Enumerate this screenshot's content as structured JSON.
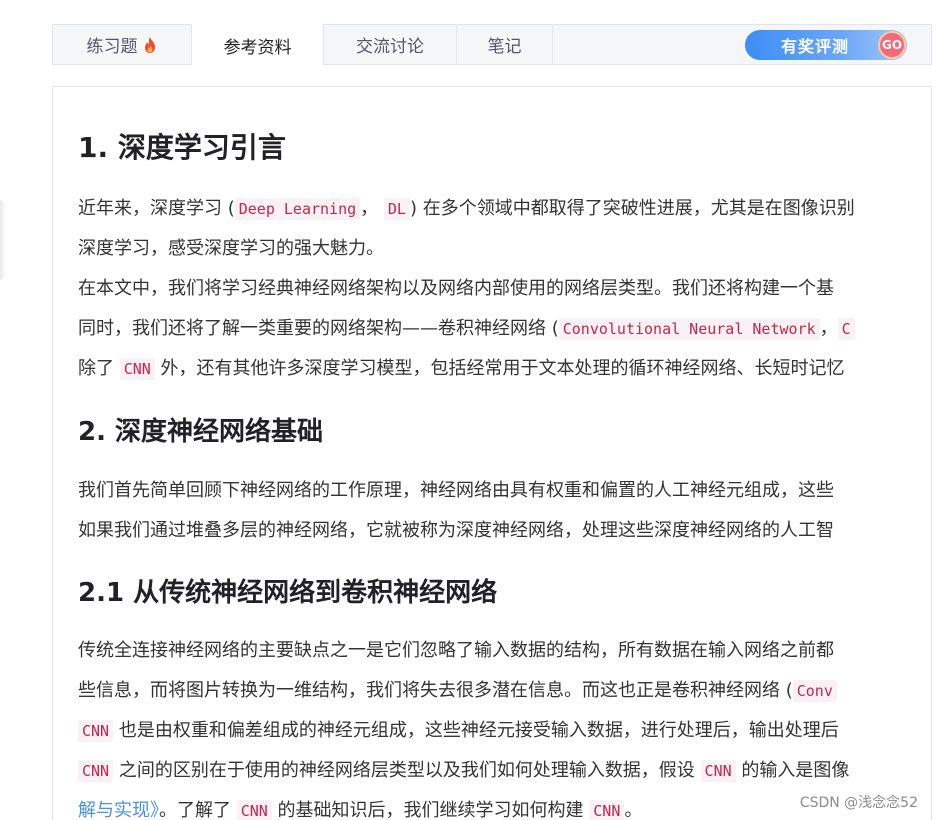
{
  "tabs": [
    {
      "label": "练习题",
      "icon": "fire-icon"
    },
    {
      "label": "参考资料"
    },
    {
      "label": "交流讨论"
    },
    {
      "label": "笔记"
    }
  ],
  "eval_button": {
    "label": "有奖评测",
    "badge": "GO"
  },
  "article": {
    "h1": "1. 深度学习引言",
    "p1": {
      "t1": "近年来，深度学习 (",
      "c1": "Deep Learning",
      "t2": "， ",
      "c2": "DL",
      "t3": ") 在多个领域中都取得了突破性进展，尤其是在图像识别",
      "line2": "深度学习，感受深度学习的强大魅力。"
    },
    "p2": {
      "line1": "在本文中，我们将学习经典神经网络架构以及网络内部使用的网络层类型。我们还将构建一个基",
      "l2_t1": "同时，我们还将了解一类重要的网络架构——卷积神经网络 (",
      "l2_c1": "Convolutional Neural Network",
      "l2_t2": "，",
      "l2_c2": "C",
      "l3_t1": "除了 ",
      "l3_c1": "CNN",
      "l3_t2": " 外，还有其他许多深度学习模型，包括经常用于文本处理的循环神经网络、长短时记忆"
    },
    "h2a": "2. 深度神经网络基础",
    "p3": {
      "line1": "我们首先简单回顾下神经网络的工作原理，神经网络由具有权重和偏置的人工神经元组成，这些",
      "line2": "如果我们通过堆叠多层的神经网络，它就被称为深度神经网络，处理这些深度神经网络的人工智"
    },
    "h2b": "2.1 从传统神经网络到卷积神经网络",
    "p4": {
      "line1": "传统全连接神经网络的主要缺点之一是它们忽略了输入数据的结构，所有数据在输入网络之前都",
      "l2_t1": "些信息，而将图片转换为一维结构，我们将失去很多潜在信息。而这也正是卷积神经网络 (",
      "l2_c1": "Conv",
      "l3_c1": "CNN",
      "l3_t1": " 也是由权重和偏差组成的神经元组成，这些神经元接受输入数据，进行处理后，输出处理后",
      "l4_c1": "CNN",
      "l4_t1": " 之间的区别在于使用的神经网络层类型以及我们如何处理输入数据，假设 ",
      "l4_c2": "CNN",
      "l4_t2": " 的输入是图像",
      "l5_link": "解与实现》",
      "l5_t1": "。了解了 ",
      "l5_c1": "CNN",
      "l5_t2": " 的基础知识后，我们继续学习如何构建 ",
      "l5_c2": "CNN",
      "l5_t3": "。"
    }
  },
  "watermark": "CSDN @浅念念52"
}
